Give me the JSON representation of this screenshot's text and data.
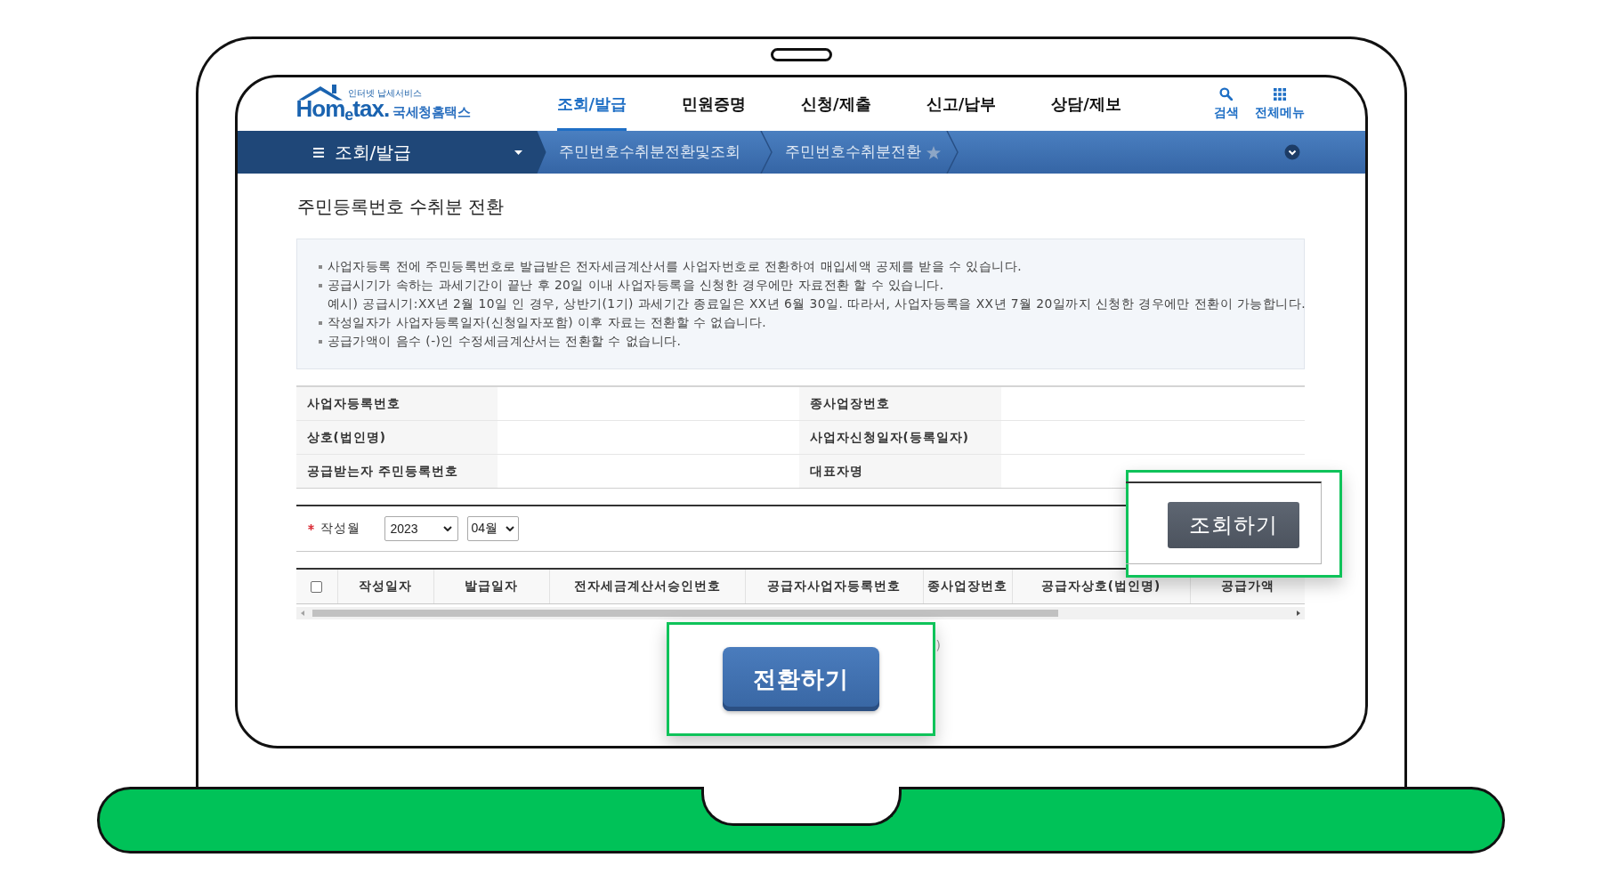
{
  "header": {
    "logo": {
      "tagline": "인터넷 납세서비스",
      "wordmark": "Hom$_{e}$tax.",
      "name": "국세청홈택스"
    },
    "nav": [
      {
        "label": "조회/발급",
        "selected": true
      },
      {
        "label": "민원증명",
        "selected": false
      },
      {
        "label": "신청/제출",
        "selected": false
      },
      {
        "label": "신고/납부",
        "selected": false
      },
      {
        "label": "상담/제보",
        "selected": false
      }
    ],
    "tools": [
      {
        "kind": "search",
        "label": "검색"
      },
      {
        "kind": "all_menu",
        "label": "전체메뉴"
      }
    ]
  },
  "subnav": {
    "menu_label": "조회/발급",
    "breadcrumb": [
      "주민번호수취분전환및조회",
      "주민번호수취분전환"
    ],
    "favorited": false
  },
  "page_title": "주민등록번호 수취분 전환",
  "notices": [
    {
      "kind": "bullet",
      "text": "사업자등록 전에 주민등록번호로 발급받은 전자세금계산서를 사업자번호로 전환하여 매입세액 공제를 받을 수 있습니다."
    },
    {
      "kind": "bullet",
      "text": "공급시기가 속하는 과세기간이 끝난 후 20일 이내 사업자등록을 신청한 경우에만 자료전환 할 수 있습니다."
    },
    {
      "kind": "continuation",
      "text": "예시) 공급시기:XX년 2월 10일 인 경우, 상반기(1기) 과세기간 종료일은 XX년 6월 30일. 따라서, 사업자등록을 XX년 7월 20일까지 신청한 경우에만 전환이 가능합니다."
    },
    {
      "kind": "bullet",
      "text": "작성일자가 사업자등록일자(신청일자포함) 이후 자료는 전환할 수 없습니다."
    },
    {
      "kind": "bullet",
      "text": "공급가액이 음수 (-)인 수정세금계산서는 전환할 수 없습니다."
    }
  ],
  "info_table": {
    "rows": [
      [
        "사업자등록번호",
        "종사업장번호"
      ],
      [
        "상호(법인명)",
        "사업자신청일자(등록일자)"
      ],
      [
        "공급받는자 주민등록번호",
        "대표자명"
      ]
    ]
  },
  "filter": {
    "label": "작성월",
    "required": true,
    "year": "2023",
    "month": "04월"
  },
  "results_table": {
    "select_all_checked": false,
    "columns": [
      "작성일자",
      "발급일자",
      "전자세금계산서승인번호",
      "공급자사업자등록번호",
      "종사업장번호",
      "공급자상호(법인명)",
      "공급가액"
    ]
  },
  "hidden_text_fragment": ")",
  "callouts": [
    {
      "kind": "search",
      "button": "조회하기"
    },
    {
      "kind": "convert",
      "button": "전환하기"
    }
  ]
}
